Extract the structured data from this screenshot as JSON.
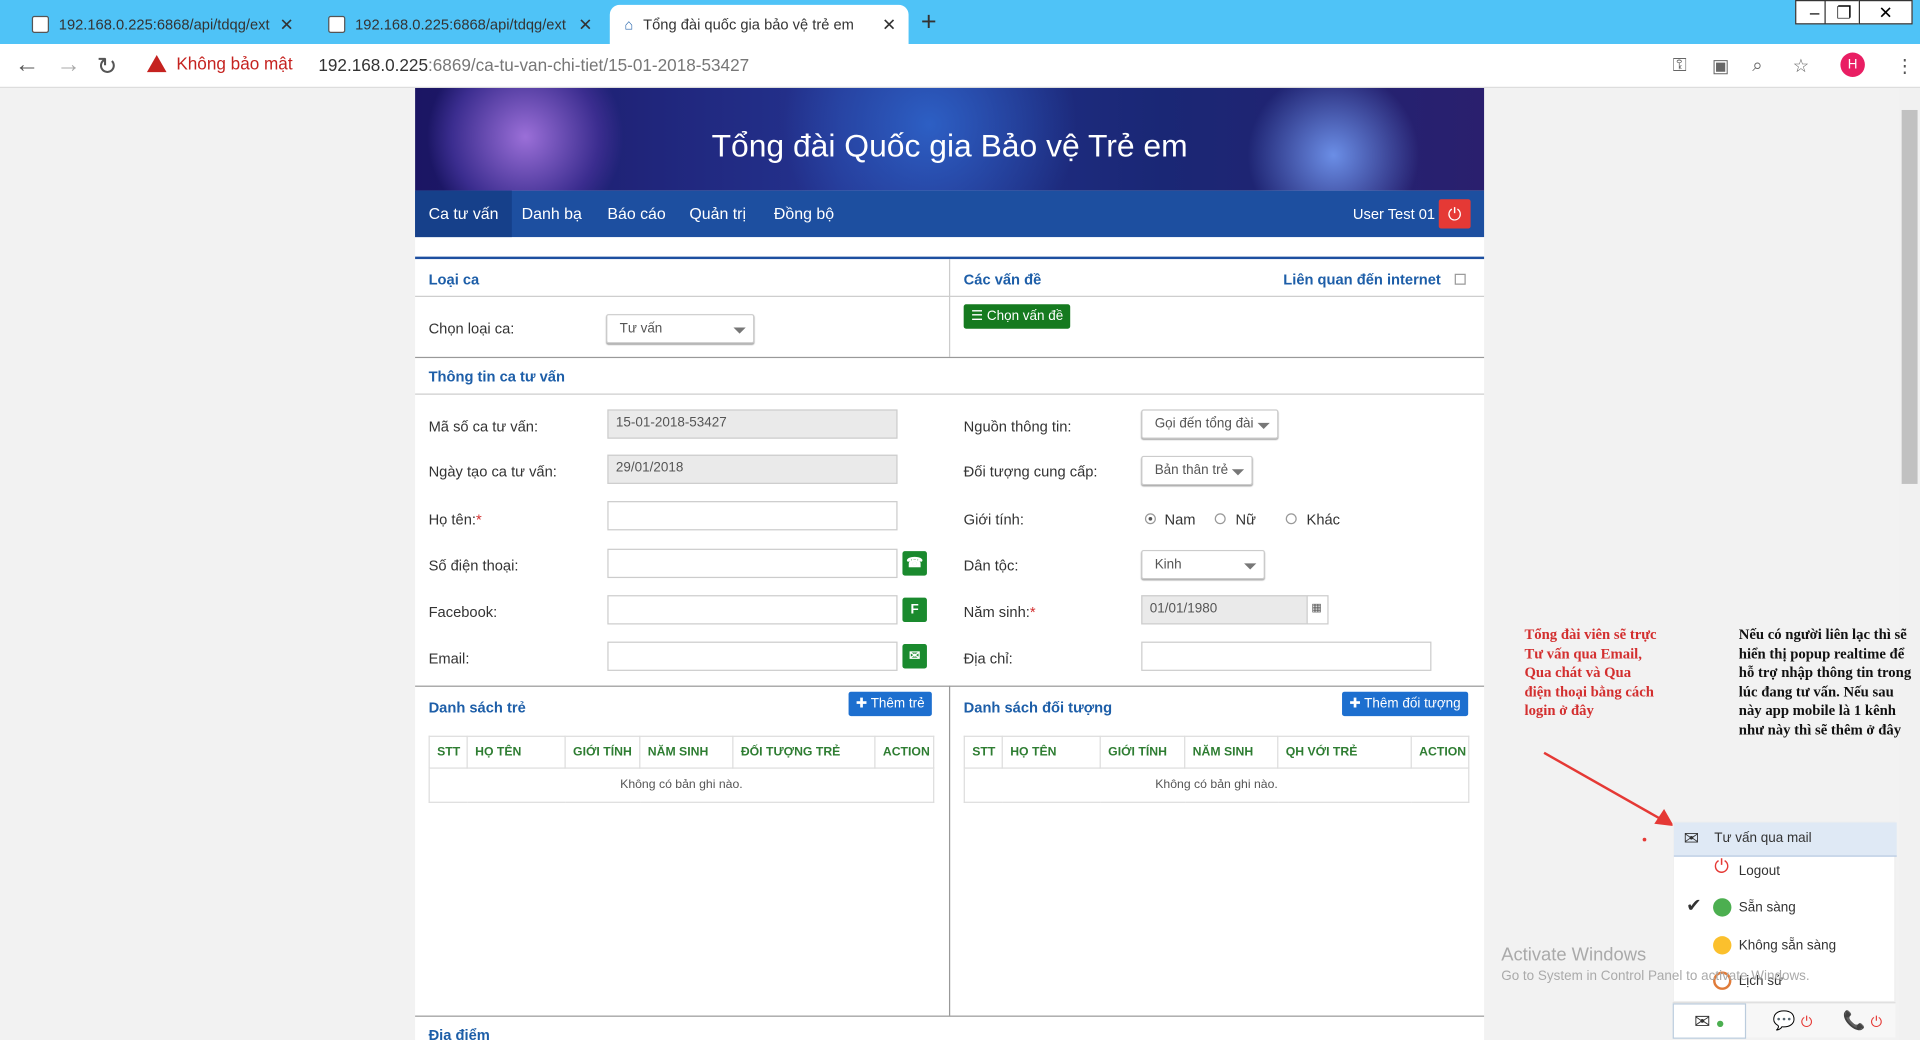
{
  "browser": {
    "tabs": [
      {
        "title": "192.168.0.225:6868/api/tdqg/ext",
        "close": "✕"
      },
      {
        "title": "192.168.0.225:6868/api/tdqg/ext",
        "close": "✕"
      },
      {
        "title": "Tổng đài quốc gia bảo vệ trẻ em",
        "close": "✕"
      }
    ],
    "new_tab": "+",
    "security": "Không bảo mật",
    "url_host": "192.168.0.225",
    "url_rest": ":6869/ca-tu-van-chi-tiet/15-01-2018-53427",
    "avatar_letter": "H"
  },
  "app": {
    "banner_title": "Tổng đài Quốc gia Bảo vệ Trẻ em",
    "nav": [
      "Ca tư vấn",
      "Danh bạ",
      "Báo cáo",
      "Quản trị",
      "Đồng bộ"
    ],
    "user": "User Test 01"
  },
  "case": {
    "loai_ca_head": "Loại ca",
    "chon_loai_ca_label": "Chọn loại ca:",
    "chon_loai_ca_value": "Tư vấn",
    "cac_van_de_head": "Các vấn đề",
    "lien_quan_internet": "Liên quan đến internet",
    "chon_van_de_btn": "Chọn vấn đề",
    "thong_tin_head": "Thông tin ca tư vấn",
    "ma_so_label": "Mã số ca tư vấn:",
    "ma_so_value": "15-01-2018-53427",
    "ngay_tao_label": "Ngày tạo ca tư vấn:",
    "ngay_tao_value": "29/01/2018",
    "ho_ten_label": "Họ tên:",
    "required_mark": "*",
    "sdt_label": "Số điện thoại:",
    "facebook_label": "Facebook:",
    "email_label": "Email:",
    "nguon_label": "Nguồn thông tin:",
    "nguon_value": "Gọi đến tổng đài",
    "doi_tuong_label": "Đối tượng cung cấp:",
    "doi_tuong_value": "Bản thân trẻ",
    "gioi_tinh_label": "Giới tính:",
    "gioi_tinh_options": [
      "Nam",
      "Nữ",
      "Khác"
    ],
    "dan_toc_label": "Dân tộc:",
    "dan_toc_value": "Kinh",
    "nam_sinh_label": "Năm sinh:",
    "nam_sinh_value": "01/01/1980",
    "dia_chi_label": "Địa chỉ:",
    "fb_icon_letter": "F",
    "ds_tre_head": "Danh sách trẻ",
    "them_tre_btn": "Thêm trẻ",
    "ds_tre_cols": [
      "STT",
      "HỌ TÊN",
      "GIỚI TÍNH",
      "NĂM SINH",
      "ĐỐI TƯỢNG TRẺ",
      "ACTION"
    ],
    "ds_doi_tuong_head": "Danh sách đối tượng",
    "them_doi_tuong_btn": "Thêm đối tượng",
    "ds_doi_tuong_cols": [
      "STT",
      "HỌ TÊN",
      "GIỚI TÍNH",
      "NĂM SINH",
      "QH VỚI TRẺ",
      "ACTION"
    ],
    "empty_text": "Không có bản ghi nào.",
    "dia_diem_head": "Địa điểm"
  },
  "annotations": {
    "left": "Tổng đài viên sẽ trực Tư vấn qua Email, Qua chát và Qua điện thoại bằng cách login ở đây",
    "right": "Nếu có người liên lạc thì sẽ hiển thị popup realtime để hỗ trợ nhập thông tin trong lúc đang tư vấn. Nếu sau này app mobile là 1 kênh như này thì sẽ thêm ở đây",
    "color": "#d32f2f"
  },
  "popup": {
    "header": "Tư vấn qua mail",
    "items": [
      "Logout",
      "Sẵn sàng",
      "Không sẵn sàng",
      "Lịch sử"
    ]
  },
  "watermark": {
    "title": "Activate Windows",
    "subtitle": "Go to System in Control Panel to activate Windows."
  }
}
